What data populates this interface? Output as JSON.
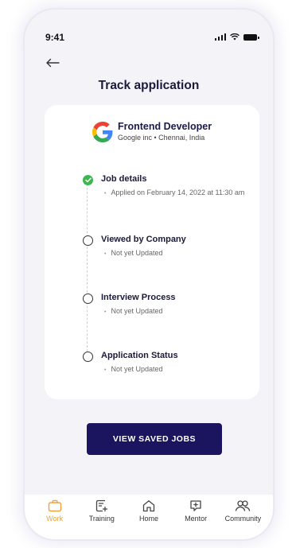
{
  "status_bar": {
    "time": "9:41"
  },
  "header": {
    "title": "Track application"
  },
  "job": {
    "title": "Frontend Developer",
    "subtitle": "Google inc • Chennai, India"
  },
  "steps": [
    {
      "title": "Job details",
      "subtitle": "Applied on February 14, 2022 at 11:30 am",
      "status": "done"
    },
    {
      "title": "Viewed by Company",
      "subtitle": "Not yet Updated",
      "status": "pending"
    },
    {
      "title": "Interview Process",
      "subtitle": "Not yet Updated",
      "status": "pending"
    },
    {
      "title": "Application Status",
      "subtitle": "Not yet Updated",
      "status": "pending"
    }
  ],
  "cta": {
    "label": "VIEW SAVED JOBS"
  },
  "tabbar": {
    "items": [
      {
        "label": "Work",
        "icon": "briefcase-icon",
        "active": true
      },
      {
        "label": "Training",
        "icon": "training-icon",
        "active": false
      },
      {
        "label": "Home",
        "icon": "home-icon",
        "active": false
      },
      {
        "label": "Mentor",
        "icon": "mentor-icon",
        "active": false
      },
      {
        "label": "Community",
        "icon": "community-icon",
        "active": false
      }
    ]
  },
  "colors": {
    "primary": "#1b1560",
    "success": "#3eb650",
    "accent": "#f2a23a",
    "background": "#f4f4f8"
  }
}
